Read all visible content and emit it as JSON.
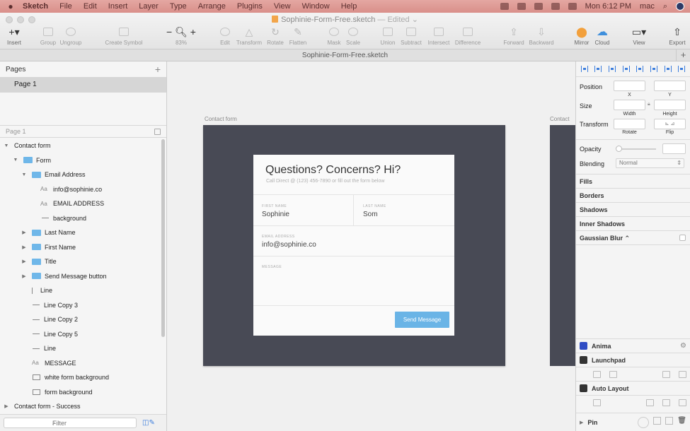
{
  "menubar": {
    "app_name": "Sketch",
    "items": [
      "File",
      "Edit",
      "Insert",
      "Layer",
      "Type",
      "Arrange",
      "Plugins",
      "View",
      "Window",
      "Help"
    ],
    "clock": "Mon 6:12 PM",
    "user": "mac"
  },
  "window": {
    "title": "Sophinie-Form-Free.sketch",
    "edited": "— Edited ⌄"
  },
  "toolbar": {
    "insert": "Insert",
    "group": "Group",
    "ungroup": "Ungroup",
    "create_symbol": "Create Symbol",
    "zoom_value": "83%",
    "edit": "Edit",
    "transform": "Transform",
    "rotate": "Rotate",
    "flatten": "Flatten",
    "mask": "Mask",
    "scale": "Scale",
    "union": "Union",
    "subtract": "Subtract",
    "intersect": "Intersect",
    "difference": "Difference",
    "forward": "Forward",
    "backward": "Backward",
    "mirror": "Mirror",
    "cloud": "Cloud",
    "view": "View",
    "export": "Export"
  },
  "tabbar": {
    "tab_title": "Sophinie-Form-Free.sketch"
  },
  "pages": {
    "header": "Pages",
    "items": [
      {
        "label": "Page 1"
      }
    ]
  },
  "layers": {
    "page_label": "Page 1",
    "items": [
      {
        "label": "Contact form"
      },
      {
        "label": "Form"
      },
      {
        "label": "Email Address"
      },
      {
        "label": "info@sophinie.co"
      },
      {
        "label": "EMAIL ADDRESS"
      },
      {
        "label": "background"
      },
      {
        "label": "Last Name"
      },
      {
        "label": "First Name"
      },
      {
        "label": "Title"
      },
      {
        "label": "Send Message button"
      },
      {
        "label": "Line"
      },
      {
        "label": "Line Copy 3"
      },
      {
        "label": "Line Copy 2"
      },
      {
        "label": "Line Copy 5"
      },
      {
        "label": "Line"
      },
      {
        "label": "MESSAGE"
      },
      {
        "label": "white form background"
      },
      {
        "label": "form background"
      },
      {
        "label": "Contact form - Success"
      }
    ],
    "filter_placeholder": "Filter"
  },
  "canvas": {
    "artboard_label": "Contact form",
    "artboard_label_2": "Contact",
    "form": {
      "title": "Questions? Concerns? Hi?",
      "subtitle": "Call Direct @ (123) 456-7890 or fill out the form below",
      "first_name_label": "FIRST NAME",
      "first_name_value": "Sophinie",
      "last_name_label": "LAST NAME",
      "last_name_value": "Som",
      "email_label": "EMAIL ADDRESS",
      "email_value": "info@sophinie.co",
      "message_label": "MESSAGE",
      "send_label": "Send Message"
    }
  },
  "inspector": {
    "position": "Position",
    "x_label": "X",
    "y_label": "Y",
    "size": "Size",
    "width_label": "Width",
    "height_label": "Height",
    "transform": "Transform",
    "rotate_label": "Rotate",
    "flip_label": "Flip",
    "opacity": "Opacity",
    "blending": "Blending",
    "blending_value": "Normal",
    "fills": "Fills",
    "borders": "Borders",
    "shadows": "Shadows",
    "inner_shadows": "Inner Shadows",
    "gaussian_blur": "Gaussian Blur ⌃",
    "anima": "Anima",
    "launchpad": "Launchpad",
    "auto_layout": "Auto Layout",
    "pin": "Pin"
  },
  "colors": {
    "menubar": "#d98f8a",
    "artboard": "#484a55",
    "accent": "#6ab4e6",
    "folder": "#6fb7e9",
    "selection": "#d6d6d6"
  }
}
